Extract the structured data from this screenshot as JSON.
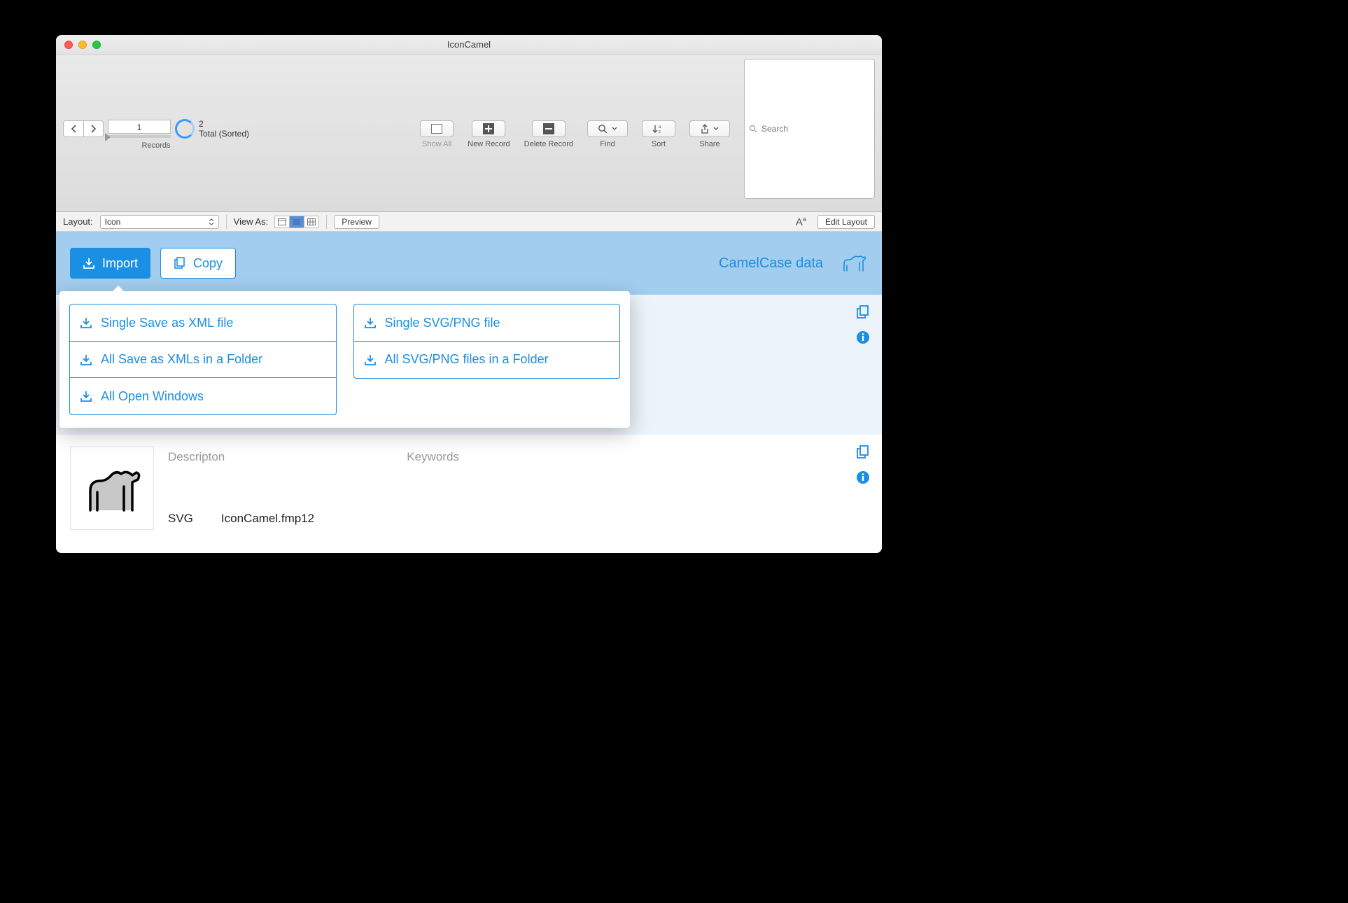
{
  "window": {
    "title": "IconCamel"
  },
  "toolbar": {
    "records_label": "Records",
    "record_current": "1",
    "record_total": "2",
    "record_sorted": "Total (Sorted)",
    "show_all": "Show All",
    "new_record": "New Record",
    "delete_record": "Delete Record",
    "find": "Find",
    "sort": "Sort",
    "share": "Share",
    "search_placeholder": "Search"
  },
  "layoutbar": {
    "layout_label": "Layout:",
    "layout_value": "Icon",
    "view_as_label": "View As:",
    "preview": "Preview",
    "edit_layout": "Edit Layout"
  },
  "header": {
    "import": "Import",
    "copy": "Copy",
    "title": "CamelCase data"
  },
  "dropdown": {
    "left": [
      "Single Save as XML file",
      "All Save as XMLs in a Folder",
      "All Open Windows"
    ],
    "right": [
      "Single SVG/PNG file",
      "All SVG/PNG files in a Folder"
    ]
  },
  "record": {
    "description_label": "Descripton",
    "keywords_label": "Keywords",
    "type": "SVG",
    "filename": "IconCamel.fmp12"
  }
}
